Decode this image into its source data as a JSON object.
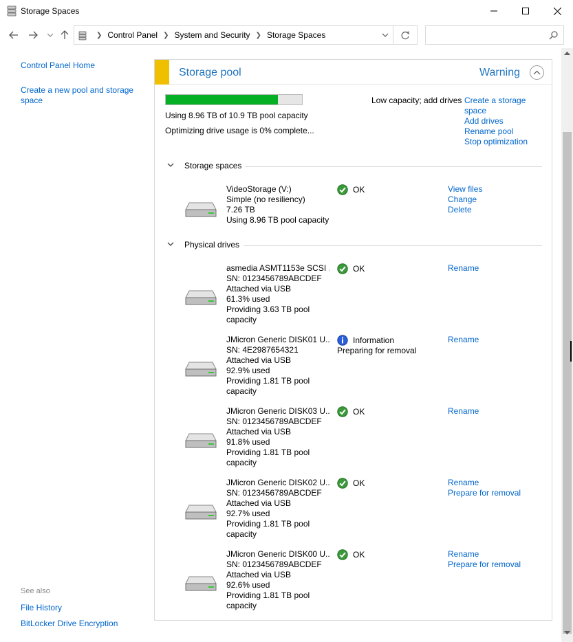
{
  "window": {
    "title": "Storage Spaces",
    "app_icon": "storage-spaces-icon",
    "controls": [
      "minimize-icon",
      "maximize-icon",
      "close-icon"
    ]
  },
  "nav": {
    "breadcrumbs": [
      "Control Panel",
      "System and Security",
      "Storage Spaces"
    ],
    "search_placeholder": ""
  },
  "left": {
    "home_link": "Control Panel Home",
    "create_link": "Create a new pool and storage space",
    "see_also": "See also",
    "file_history": "File History",
    "bitlocker": "BitLocker Drive Encryption"
  },
  "pool": {
    "title": "Storage pool",
    "status": "Warning",
    "accent_color": "#f0c000",
    "usage_fraction": 0.822,
    "usage_text": "Using 8.96 TB of 10.9 TB pool capacity",
    "optimizing_text": "Optimizing drive usage is 0% complete...",
    "low_capacity": "Low capacity; add drives",
    "actions": {
      "create": "Create a storage space",
      "add": "Add drives",
      "rename": "Rename pool",
      "stop": "Stop optimization"
    }
  },
  "spaces_section": "Storage spaces",
  "drives_section": "Physical drives",
  "spaces": [
    {
      "lines": [
        "VideoStorage (V:)",
        "Simple (no resiliency)",
        "7.26 TB",
        "Using 8.96 TB pool capacity"
      ],
      "status": "OK",
      "status_icon": "ok-check-icon",
      "links": [
        "View files",
        "Change",
        "Delete"
      ]
    }
  ],
  "drives": [
    {
      "lines": [
        "asmedia ASMT1153e SCSI ...",
        "SN: 0123456789ABCDEF",
        "Attached via USB",
        "61.3% used",
        "Providing 3.63 TB pool",
        "capacity"
      ],
      "status": "OK",
      "status_sub": "",
      "status_icon": "ok-check-icon",
      "links": [
        "Rename"
      ]
    },
    {
      "lines": [
        "JMicron Generic DISK01 U...",
        "SN: 4E2987654321",
        "Attached via USB",
        "92.9% used",
        "Providing 1.81 TB pool",
        "capacity"
      ],
      "status": "Information",
      "status_sub": "Preparing for removal",
      "status_icon": "information-icon",
      "links": [
        "Rename"
      ]
    },
    {
      "lines": [
        "JMicron Generic DISK03 U...",
        "SN: 0123456789ABCDEF",
        "Attached via USB",
        "91.8% used",
        "Providing 1.81 TB pool",
        "capacity"
      ],
      "status": "OK",
      "status_sub": "",
      "status_icon": "ok-check-icon",
      "links": [
        "Rename"
      ]
    },
    {
      "lines": [
        "JMicron Generic DISK02 U...",
        "SN: 0123456789ABCDEF",
        "Attached via USB",
        "92.7% used",
        "Providing 1.81 TB pool",
        "capacity"
      ],
      "status": "OK",
      "status_sub": "",
      "status_icon": "ok-check-icon",
      "links": [
        "Rename",
        "Prepare for removal"
      ]
    },
    {
      "lines": [
        "JMicron Generic DISK00 U...",
        "SN: 0123456789ABCDEF",
        "Attached via USB",
        "92.6% used",
        "Providing 1.81 TB pool",
        "capacity"
      ],
      "status": "OK",
      "status_sub": "",
      "status_icon": "ok-check-icon",
      "links": [
        "Rename",
        "Prepare for removal"
      ]
    }
  ]
}
